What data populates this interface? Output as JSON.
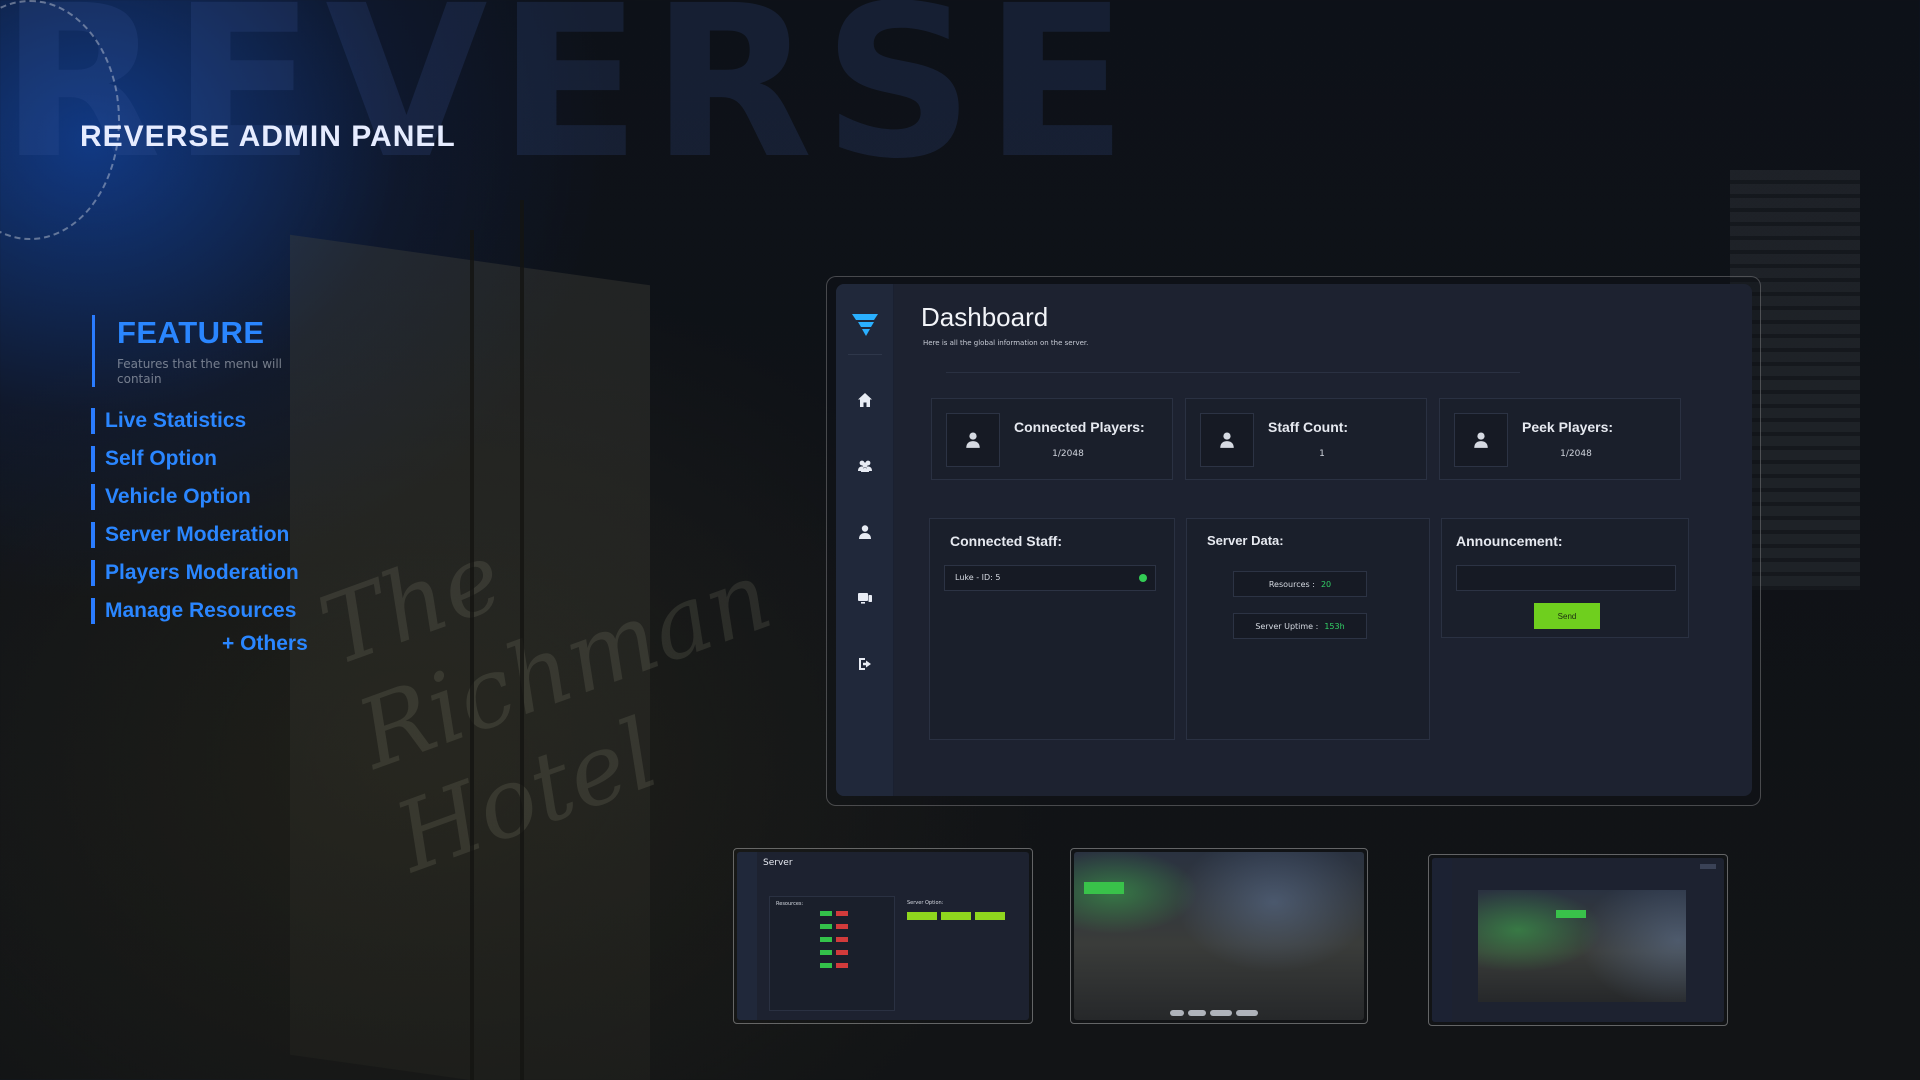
{
  "background": {
    "word": "REVERSE",
    "script_text": "The\nRichman\nHotel"
  },
  "brand": {
    "title": "REVERSE ADMIN PANEL",
    "accent_color": "#2a86ff"
  },
  "feature": {
    "title": "FEATURE",
    "subtitle": "Features that the menu will contain",
    "items": [
      "Live Statistics",
      "Self Option",
      "Vehicle Option",
      "Server Moderation",
      "Players Moderation",
      "Manage Resources"
    ],
    "others": "+ Others"
  },
  "dashboard": {
    "title": "Dashboard",
    "subtitle": "Here is all the global information on the server.",
    "sidebar_icons": [
      "home-icon",
      "users-icon",
      "user-icon",
      "vehicle-icon",
      "logout-icon"
    ],
    "stats": [
      {
        "label": "Connected Players:",
        "value": "1/2048"
      },
      {
        "label": "Staff Count:",
        "value": "1"
      },
      {
        "label": "Peek Players:",
        "value": "1/2048"
      }
    ],
    "connected_staff": {
      "title": "Connected Staff:",
      "entries": [
        {
          "name": "Luke - ID: 5",
          "status_color": "#33cc55"
        }
      ]
    },
    "server_data": {
      "title": "Server Data:",
      "resources_label": "Resources :",
      "resources_value": "20",
      "uptime_label": "Server Uptime :",
      "uptime_value": "153h",
      "value_color": "#33d066"
    },
    "announcement": {
      "title": "Announcement:",
      "input_value": "",
      "send_label": "Send",
      "send_color": "#6fcf1e"
    }
  },
  "thumbnails": {
    "server_panel": {
      "title": "Server",
      "resources_title": "Resources:",
      "options_title": "Server Option:"
    },
    "scene_sign": "",
    "scene_sign_right": ""
  }
}
